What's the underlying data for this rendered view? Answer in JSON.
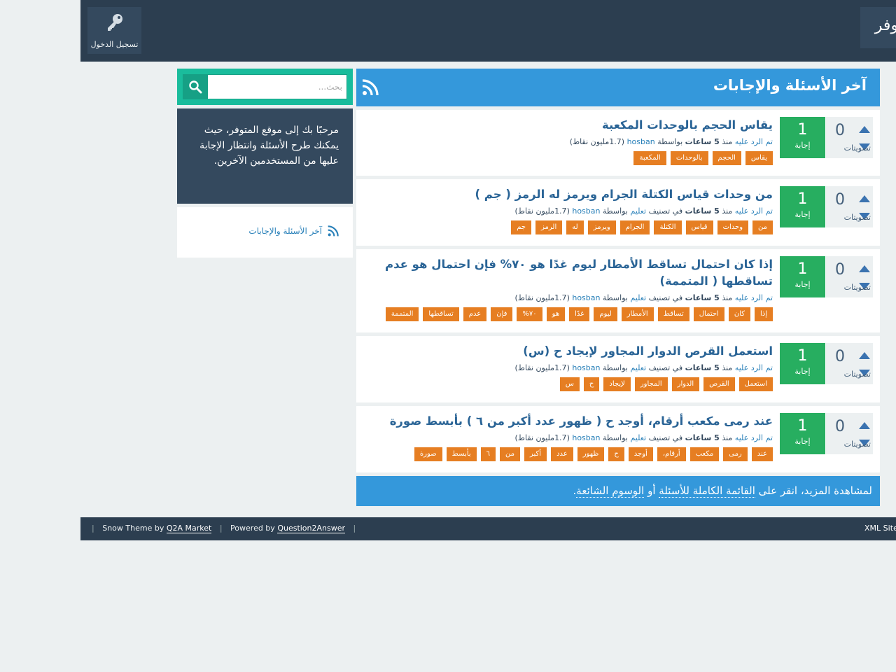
{
  "header": {
    "logo_text": "المتوفر",
    "login_label": "تسجيل الدخول"
  },
  "main": {
    "title": "آخر الأسئلة والإجابات"
  },
  "questions": [
    {
      "votes": "0",
      "votes_label": "تصويتات",
      "answers": "1",
      "answers_label": "إجابة",
      "title": "يقاس الحجم بالوحدات المكعبة",
      "meta_answered": "تم الرد عليه",
      "meta_since": "منذ",
      "meta_time": "5 ساعات",
      "meta_category_prefix": "",
      "meta_category": "",
      "meta_by": "بواسطة",
      "meta_user": "hosban",
      "meta_points": "(1.7مليون نقاط)",
      "tags": [
        "يقاس",
        "الحجم",
        "بالوحدات",
        "المكعبة"
      ]
    },
    {
      "votes": "0",
      "votes_label": "تصويتات",
      "answers": "1",
      "answers_label": "إجابة",
      "title": "من وحدات قياس الكتلة الجرام ويرمز له الرمز ( جم )",
      "meta_answered": "تم الرد عليه",
      "meta_since": "منذ",
      "meta_time": "5 ساعات",
      "meta_category_prefix": "في تصنيف",
      "meta_category": "تعليم",
      "meta_by": "بواسطة",
      "meta_user": "hosban",
      "meta_points": "(1.7مليون نقاط)",
      "tags": [
        "من",
        "وحدات",
        "قياس",
        "الكتلة",
        "الجرام",
        "ويرمز",
        "له",
        "الرمز",
        "جم"
      ]
    },
    {
      "votes": "0",
      "votes_label": "تصويتات",
      "answers": "1",
      "answers_label": "إجابة",
      "title": "إذا كان احتمال تساقط الأمطار ليوم غدًا هو ٧٠% فإن احتمال هو عدم تساقطها ( المتممة)",
      "meta_answered": "تم الرد عليه",
      "meta_since": "منذ",
      "meta_time": "5 ساعات",
      "meta_category_prefix": "في تصنيف",
      "meta_category": "تعليم",
      "meta_by": "بواسطة",
      "meta_user": "hosban",
      "meta_points": "(1.7مليون نقاط)",
      "tags": [
        "إذا",
        "كان",
        "احتمال",
        "تساقط",
        "الأمطار",
        "ليوم",
        "غدًا",
        "هو",
        "٧٠%",
        "فإن",
        "عدم",
        "تساقطها",
        "المتممة"
      ]
    },
    {
      "votes": "0",
      "votes_label": "تصويتات",
      "answers": "1",
      "answers_label": "إجابة",
      "title": "استعمل القرص الدوار المجاور لإيجاد ح (س)",
      "meta_answered": "تم الرد عليه",
      "meta_since": "منذ",
      "meta_time": "5 ساعات",
      "meta_category_prefix": "في تصنيف",
      "meta_category": "تعليم",
      "meta_by": "بواسطة",
      "meta_user": "hosban",
      "meta_points": "(1.7مليون نقاط)",
      "tags": [
        "استعمل",
        "القرص",
        "الدوار",
        "المجاور",
        "لإيجاد",
        "ح",
        "س"
      ]
    },
    {
      "votes": "0",
      "votes_label": "تصويتات",
      "answers": "1",
      "answers_label": "إجابة",
      "title": "عند رمى مكعب أرقام، أوجد ح ( ظهور عدد أكبر من ٦ ) بأبسط صورة",
      "meta_answered": "تم الرد عليه",
      "meta_since": "منذ",
      "meta_time": "5 ساعات",
      "meta_category_prefix": "في تصنيف",
      "meta_category": "تعليم",
      "meta_by": "بواسطة",
      "meta_user": "hosban",
      "meta_points": "(1.7مليون نقاط)",
      "tags": [
        "عند",
        "رمى",
        "مكعب",
        "أرقام،",
        "أوجد",
        "ح",
        "ظهور",
        "عدد",
        "أكبر",
        "من",
        "٦",
        "بأبسط",
        "صورة"
      ]
    }
  ],
  "suggest": {
    "prefix": "لمشاهدة المزيد، انقر على",
    "link1": "القائمة الكاملة للأسئلة",
    "middle": "أو",
    "link2": "الوسوم الشائعة",
    "suffix": "."
  },
  "sidebar": {
    "search_placeholder": "بحث...",
    "welcome": "مرحبًا بك إلى موقع المتوفر، حيث يمكنك طرح الأسئلة وانتظار الإجابة عليها من المستخدمين الآخرين.",
    "feed_link": "آخر الأسئلة والإجابات"
  },
  "footer": {
    "theme_prefix": "Snow Theme by",
    "theme_link": "Q2A Market",
    "powered_prefix": "Powered by",
    "powered_link": "Question2Answer",
    "xml": "XML Sitemap"
  },
  "colors": {
    "header_bg": "#2c3e50",
    "accent_blue": "#3498db",
    "answers_green": "#27ae60",
    "tag_orange": "#e67e22",
    "search_teal": "#1abc9c"
  }
}
